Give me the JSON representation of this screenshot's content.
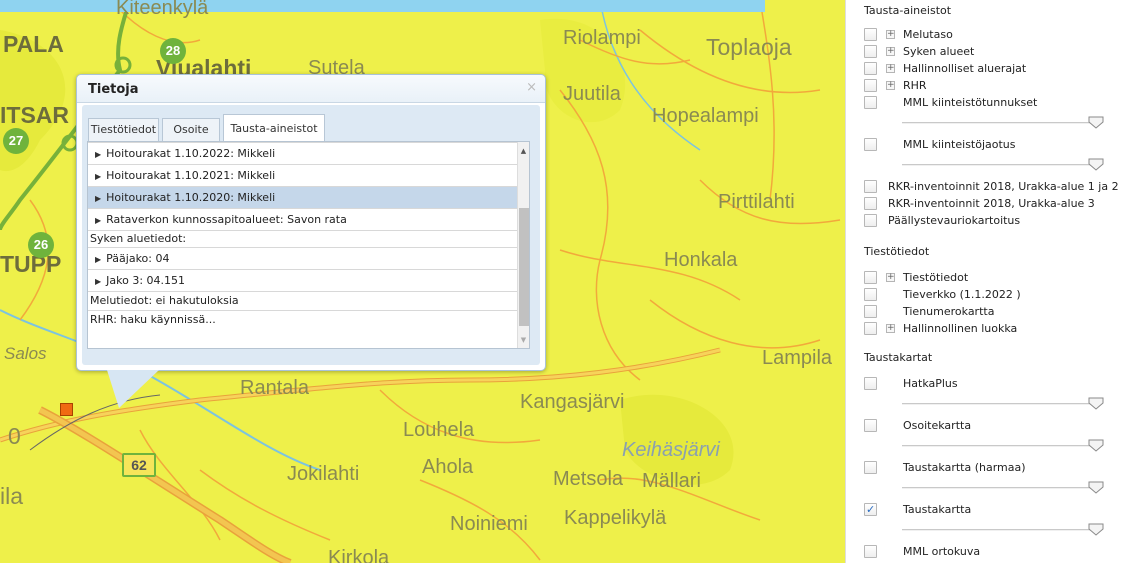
{
  "map": {
    "places": [
      {
        "id": "kitee",
        "text": "Kiteenkylä"
      },
      {
        "id": "pala",
        "text": "PALA"
      },
      {
        "id": "viualahti",
        "text": "Viualahti"
      },
      {
        "id": "sutela",
        "text": "Sutela"
      },
      {
        "id": "riolampi",
        "text": "Riolampi"
      },
      {
        "id": "toplaoja",
        "text": "Toplaoja"
      },
      {
        "id": "juutila",
        "text": "Juutila"
      },
      {
        "id": "hopealampi",
        "text": "Hopealampi"
      },
      {
        "id": "itsar",
        "text": "ITSAR"
      },
      {
        "id": "pirttilahti",
        "text": "Pirttilahti"
      },
      {
        "id": "honkala",
        "text": "Honkala"
      },
      {
        "id": "tupp",
        "text": "TUPP"
      },
      {
        "id": "lampila",
        "text": "Lampila"
      },
      {
        "id": "salos",
        "text": "Salos"
      },
      {
        "id": "rantala",
        "text": "Rantala"
      },
      {
        "id": "kangasjarvi",
        "text": "Kangasjärvi"
      },
      {
        "id": "louhela",
        "text": "Louhela"
      },
      {
        "id": "keihasjarvi",
        "text": "Keihäsjärvi"
      },
      {
        "id": "ahola",
        "text": "Ahola"
      },
      {
        "id": "jokilahti",
        "text": "Jokilahti"
      },
      {
        "id": "metsola",
        "text": "Metsola"
      },
      {
        "id": "mallari",
        "text": "Mällari"
      },
      {
        "id": "noiniemi",
        "text": "Noiniemi"
      },
      {
        "id": "kappelikyla",
        "text": "Kappelikylä"
      },
      {
        "id": "kirkola",
        "text": "Kirkola"
      },
      {
        "id": "o",
        "text": "0"
      },
      {
        "id": "ila",
        "text": "ila"
      }
    ],
    "roads": {
      "r28": "28",
      "r27": "27",
      "r26": "26",
      "r62": "62"
    }
  },
  "popup": {
    "title": "Tietoja",
    "close": "×",
    "tabs": [
      "Tiestötiedot",
      "Osoite",
      "Tausta-aineistot"
    ],
    "active_tab": 2,
    "rows": [
      {
        "text": "Hoitourakat 1.10.2022: Mikkeli",
        "arrow": true,
        "selected": false
      },
      {
        "text": "Hoitourakat 1.10.2021: Mikkeli",
        "arrow": true,
        "selected": false
      },
      {
        "text": "Hoitourakat 1.10.2020: Mikkeli",
        "arrow": true,
        "selected": true
      },
      {
        "text": "Rataverkon kunnossapitoalueet: Savon rata",
        "arrow": true,
        "selected": false
      },
      {
        "text": "Syken aluetiedot:",
        "arrow": false,
        "selected": false
      },
      {
        "text": "Pääjako: 04",
        "arrow": true,
        "selected": false
      },
      {
        "text": "Jako 3: 04.151",
        "arrow": true,
        "selected": false
      },
      {
        "text": "Melutiedot: ei hakutuloksia",
        "arrow": false,
        "selected": false
      },
      {
        "text": "RHR: haku käynnissä...",
        "arrow": false,
        "selected": false
      }
    ]
  },
  "panel": {
    "sections": {
      "tausta": "Tausta-aineistot",
      "tiestotiedot": "Tiestötiedot",
      "taustakartat": "Taustakartat"
    },
    "layers": {
      "melutaso": {
        "label": "Melutaso",
        "checked": false
      },
      "syken": {
        "label": "Syken alueet",
        "checked": false
      },
      "hallinnolliset": {
        "label": "Hallinnolliset aluerajat",
        "checked": false
      },
      "rhr": {
        "label": "RHR",
        "checked": false
      },
      "mml_tunnukset": {
        "label": "MML kiinteistötunnukset",
        "checked": false
      },
      "mml_jaotus": {
        "label": "MML kiinteistöjaotus",
        "checked": false
      },
      "rkr1": {
        "label": "RKR-inventoinnit 2018, Urakka-alue 1 ja 2",
        "checked": false
      },
      "rkr3": {
        "label": "RKR-inventoinnit 2018, Urakka-alue 3",
        "checked": false
      },
      "paallyste": {
        "label": "Päällystevauriokartoitus",
        "checked": false
      },
      "tiestotiedot": {
        "label": "Tiestötiedot",
        "checked": false
      },
      "tieverkko": {
        "label": "Tieverkko (1.1.2022 )",
        "checked": false
      },
      "tienumero": {
        "label": "Tienumerokartta",
        "checked": false
      },
      "hallinnollinen_luokka": {
        "label": "Hallinnollinen luokka",
        "checked": false
      },
      "hatkaplus": {
        "label": "HatkaPlus",
        "checked": false
      },
      "osoitekartta": {
        "label": "Osoitekartta",
        "checked": false
      },
      "taustakartta_harmaa": {
        "label": "Taustakartta (harmaa)",
        "checked": false
      },
      "taustakartta": {
        "label": "Taustakartta",
        "checked": true
      },
      "ortokuva": {
        "label": "MML ortokuva",
        "checked": false
      }
    }
  }
}
